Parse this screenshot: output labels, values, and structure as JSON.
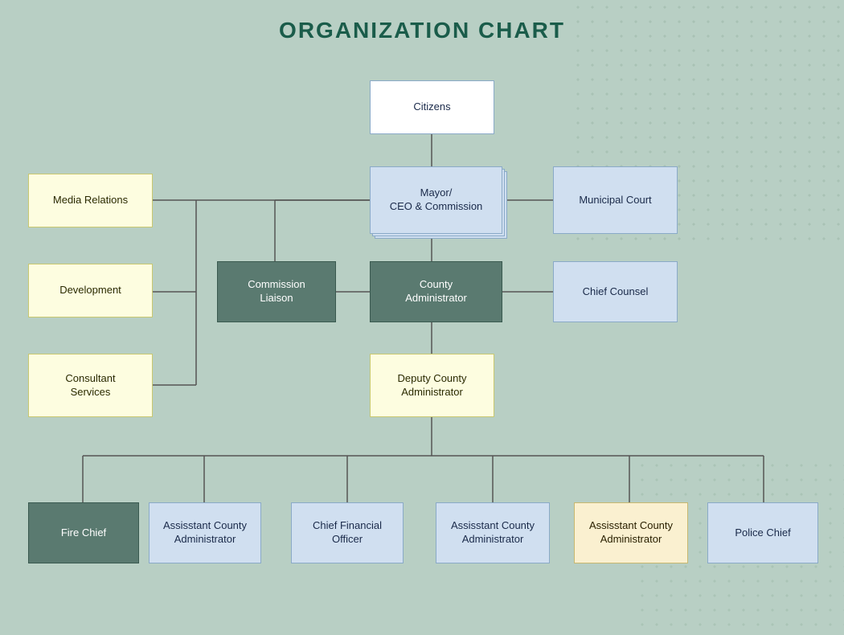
{
  "title": "ORGANIZATION CHART",
  "nodes": {
    "citizens": {
      "label": "Citizens"
    },
    "mayor": {
      "label": "Mayor/\nCEO & Commission"
    },
    "municipal_court": {
      "label": "Municipal Court"
    },
    "media_relations": {
      "label": "Media Relations"
    },
    "development": {
      "label": "Development"
    },
    "consultant_services": {
      "label": "Consultant\nServices"
    },
    "commission_liaison": {
      "label": "Commission\nLiaison"
    },
    "county_administrator": {
      "label": "County\nAdministrator"
    },
    "chief_counsel": {
      "label": "Chief Counsel"
    },
    "deputy_county_admin": {
      "label": "Deputy County\nAdministrator"
    },
    "fire_chief": {
      "label": "Fire Chief"
    },
    "asst_admin_1": {
      "label": "Assisstant County\nAdministrator"
    },
    "cfo": {
      "label": "Chief Financial\nOfficer"
    },
    "asst_admin_2": {
      "label": "Assisstant County\nAdministrator"
    },
    "asst_admin_3": {
      "label": "Assisstant County\nAdministrator"
    },
    "police_chief": {
      "label": "Police Chief"
    }
  }
}
